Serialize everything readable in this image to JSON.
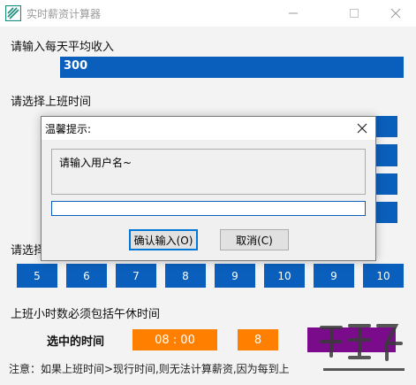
{
  "window": {
    "title": "实时薪资计算器",
    "minimize_icon": "minimize-icon",
    "maximize_icon": "maximize-icon",
    "close_icon": "close-icon"
  },
  "income": {
    "label": "请输入每天平均收入",
    "value": "300"
  },
  "work_start": {
    "label": "请选择上班时间"
  },
  "hours": {
    "label": "请选择",
    "values": [
      "5",
      "6",
      "7",
      "8",
      "9",
      "10",
      "9",
      "10"
    ]
  },
  "note_lunch": "上班小时数必须包括午休时间",
  "selected": {
    "label": "选中的时间",
    "time": "08 : 00",
    "hours": "8"
  },
  "footer_note": "注意：如果上班时间>现行时间,则无法计算薪资,因为每到上",
  "dialog": {
    "title": "温馨提示:",
    "message": "请输入用户名~",
    "input_value": "",
    "ok_label": "确认输入(O)",
    "cancel_label": "取消(C)"
  },
  "colors": {
    "blue": "#0b5fbc",
    "orange": "#ff7f00",
    "purple": "#7a0c8c"
  }
}
